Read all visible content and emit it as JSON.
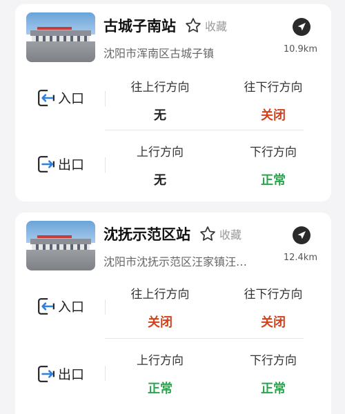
{
  "colors": {
    "closed": "#d0421b",
    "normal": "#2aa44e",
    "accent": "#222222"
  },
  "stations": [
    {
      "name": "古城子南站",
      "favorite_label": "收藏",
      "address": "沈阳市浑南区古城子镇",
      "distance": "10.9km",
      "entrance": {
        "label": "入口",
        "up_label": "往上行方向",
        "up_status": "无",
        "down_label": "往下行方向",
        "down_status": "关闭"
      },
      "exit": {
        "label": "出口",
        "up_label": "上行方向",
        "up_status": "无",
        "down_label": "下行方向",
        "down_status": "正常"
      }
    },
    {
      "name": "沈抚示范区站",
      "favorite_label": "收藏",
      "address": "沈阳市沈抚示范区汪家镇汪…",
      "distance": "12.4km",
      "entrance": {
        "label": "入口",
        "up_label": "往上行方向",
        "up_status": "关闭",
        "down_label": "往下行方向",
        "down_status": "关闭"
      },
      "exit": {
        "label": "出口",
        "up_label": "上行方向",
        "up_status": "正常",
        "down_label": "下行方向",
        "down_status": "正常"
      }
    }
  ]
}
